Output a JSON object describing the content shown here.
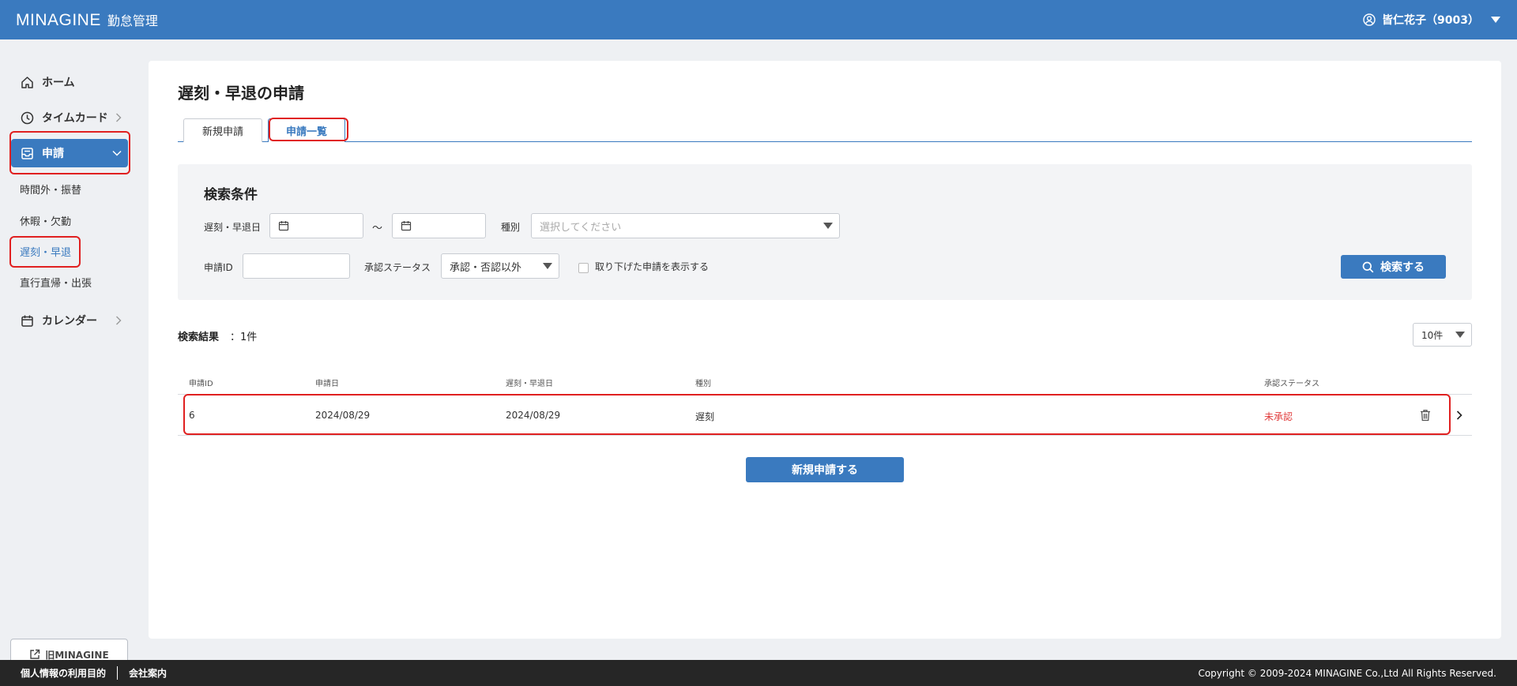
{
  "header": {
    "brand": "MINAGINE",
    "app_name": "勤怠管理",
    "user_name": "皆仁花子（9003）"
  },
  "sidebar": {
    "items": [
      {
        "label": "ホーム",
        "icon": "home-icon"
      },
      {
        "label": "タイムカード",
        "icon": "clock-icon"
      },
      {
        "label": "申請",
        "icon": "inbox-icon"
      },
      {
        "label": "カレンダー",
        "icon": "calendar-icon"
      }
    ],
    "sub_items": [
      "時間外・振替",
      "休暇・欠勤",
      "遅刻・早退",
      "直行直帰・出張"
    ],
    "old_link": "旧MINAGINE"
  },
  "main": {
    "title": "遅刻・早退の申請",
    "tabs": [
      "新規申請",
      "申請一覧"
    ]
  },
  "search": {
    "title": "検索条件",
    "date_label": "遅刻・早退日",
    "tilde": "～",
    "type_label": "種別",
    "type_placeholder": "選択してください",
    "id_label": "申請ID",
    "status_label": "承認ステータス",
    "status_value": "承認・否認以外",
    "withdrawn_label": "取り下げた申請を表示する",
    "search_button": "検索する"
  },
  "results": {
    "label": "検索結果",
    "count": "：1件",
    "per_page": "10件",
    "columns": [
      "申請ID",
      "申請日",
      "遅刻・早退日",
      "種別",
      "承認ステータス"
    ],
    "rows": [
      {
        "id": "6",
        "applied_date": "2024/08/29",
        "target_date": "2024/08/29",
        "type": "遅刻",
        "status": "未承認"
      }
    ],
    "new_button": "新規申請する"
  },
  "footer": {
    "privacy": "個人情報の利用目的",
    "company": "会社案内",
    "copyright": "Copyright © 2009-2024 MINAGINE Co.,Ltd All Rights Reserved."
  },
  "colors": {
    "primary": "#3a7abf",
    "highlight": "#e02020",
    "status_pending": "#e03a3a",
    "footer_bg": "#262626"
  }
}
